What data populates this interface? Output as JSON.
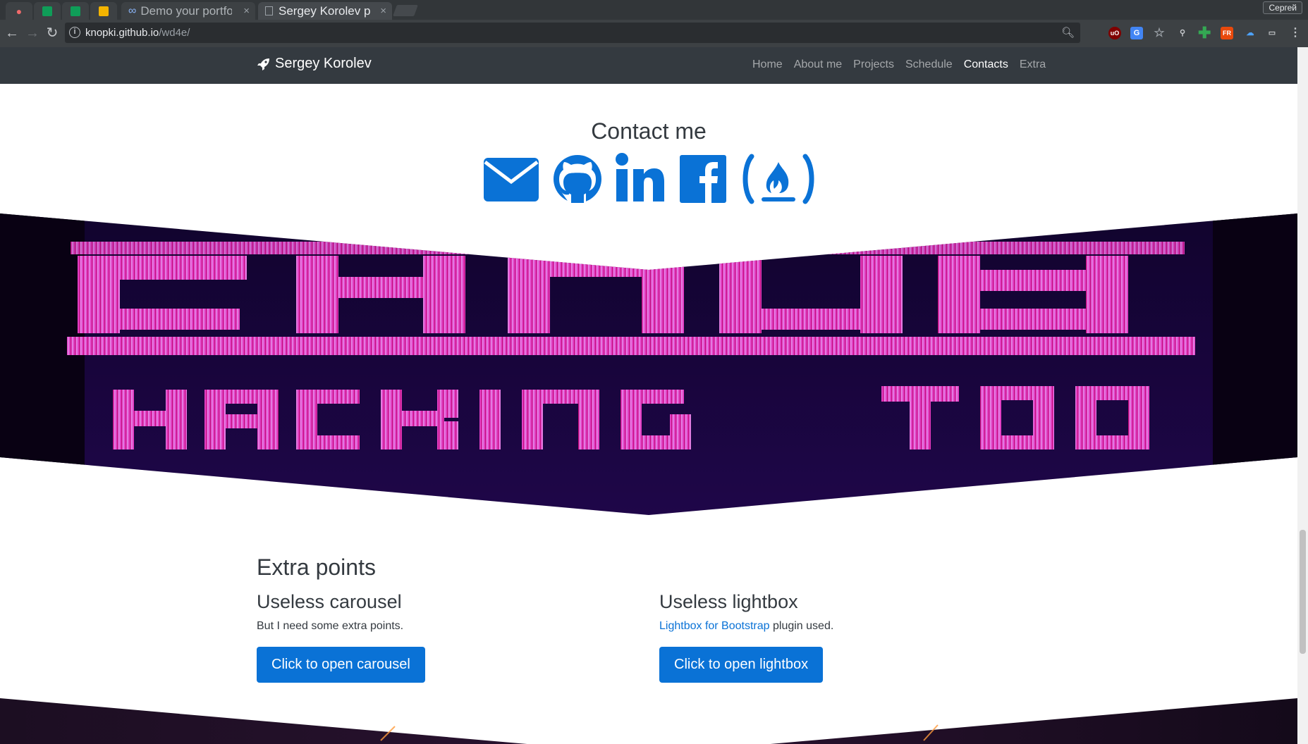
{
  "browser": {
    "tabs": [
      {
        "label": "Demo your portfolio",
        "active": false
      },
      {
        "label": "Sergey Korolev portfolio",
        "active": true
      }
    ],
    "profile": "Сергей",
    "url_host": "knopki.github.io",
    "url_path": "/wd4e/",
    "close_glyph": "×"
  },
  "site": {
    "brand": "Sergey Korolev",
    "nav": [
      {
        "label": "Home",
        "active": false
      },
      {
        "label": "About me",
        "active": false
      },
      {
        "label": "Projects",
        "active": false
      },
      {
        "label": "Schedule",
        "active": false
      },
      {
        "label": "Contacts",
        "active": true
      },
      {
        "label": "Extra",
        "active": false
      }
    ]
  },
  "contact": {
    "title": "Contact me",
    "icons": [
      "envelope-icon",
      "github-icon",
      "linkedin-icon",
      "facebook-icon",
      "freecodecamp-icon"
    ]
  },
  "extra": {
    "title": "Extra points",
    "carousel": {
      "title": "Useless carousel",
      "text": "But I need some extra points.",
      "button": "Click to open carousel"
    },
    "lightbox": {
      "title": "Useless lightbox",
      "link": "Lightbox for Bootstrap",
      "text_after": " plugin used.",
      "button": "Click to open lightbox"
    }
  },
  "colors": {
    "accent": "#0a72d6",
    "navbar": "#343a40",
    "neon": "#ff3fc0"
  }
}
